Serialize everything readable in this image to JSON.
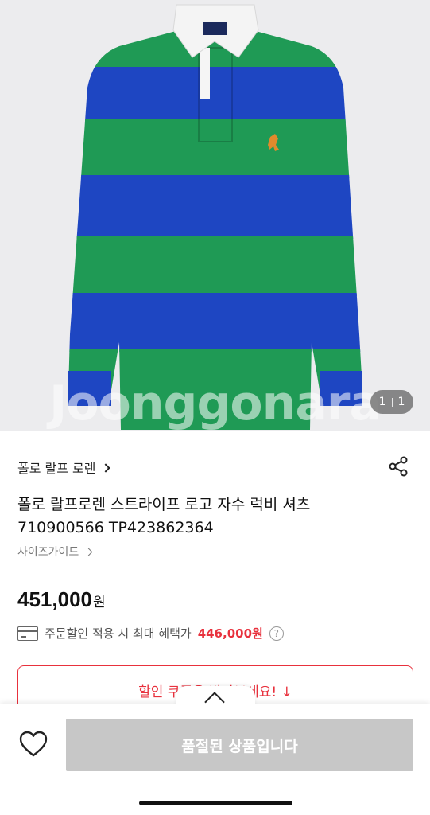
{
  "gallery": {
    "watermark": "Joonggonara",
    "counter_current": "1",
    "counter_total": "1",
    "shirt_colors": {
      "green": "#1f9a55",
      "blue": "#1e46c2",
      "collar": "#f2f2f2",
      "logo": "#e08a2c"
    }
  },
  "product": {
    "brand": "폴로 랄프 로렌",
    "name": "폴로 랄프로렌 스트라이프 로고 자수 럭비 셔츠 710900566 TP423862364",
    "size_guide": "사이즈가이드",
    "price": "451,000",
    "currency": "원",
    "benefit_label": "주문할인 적용 시 최대 혜택가",
    "benefit_price": "446,000원",
    "benefit_help": "?"
  },
  "coupon": {
    "label": "할인 쿠폰을 받아보세요! ↓"
  },
  "bottom_bar": {
    "soldout_label": "품절된 상품입니다"
  },
  "colors": {
    "accent": "#e8313d",
    "disabled": "#c7c7c7"
  }
}
